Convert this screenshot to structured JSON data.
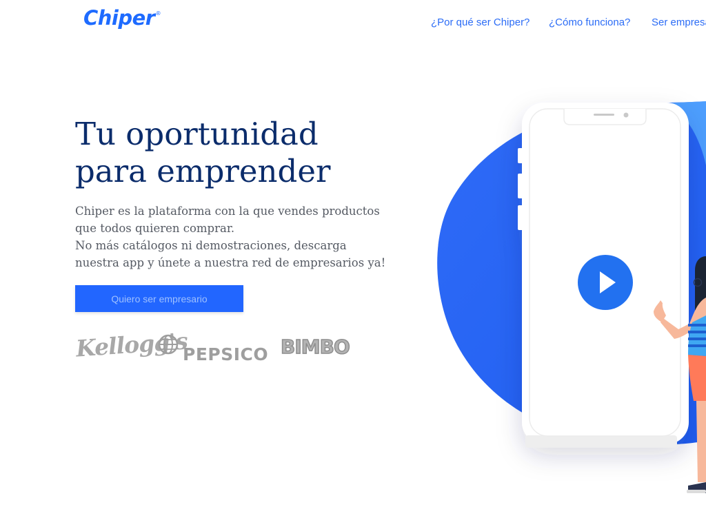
{
  "header": {
    "logo_text": "Chiper",
    "logo_mark": "®",
    "nav": [
      {
        "label": "¿Por qué ser Chiper?"
      },
      {
        "label": "¿Cómo funciona?"
      },
      {
        "label": "Ser empresario"
      }
    ]
  },
  "hero": {
    "title_line1": "Tu oportunidad",
    "title_line2": "para emprender",
    "description_lines": [
      "Chiper es la plataforma con la que vendes productos",
      "que todos quieren comprar.",
      "No más catálogos ni demostraciones, descarga",
      "nuestra app y únete a nuestra red de empresarios ya!"
    ],
    "cta_label": "Quiero ser empresario"
  },
  "brands": {
    "kelloggs": "Kellogg's",
    "pepsico": "PEPSICO",
    "bimbo": "BIMBO"
  },
  "illustration": {
    "play_icon": "play-icon"
  },
  "colors": {
    "brand_blue": "#1E6BFF",
    "nav_link": "#2B6CF6",
    "title": "#0B2C6B",
    "button": "#2266FF",
    "blob": "#2466F5"
  }
}
